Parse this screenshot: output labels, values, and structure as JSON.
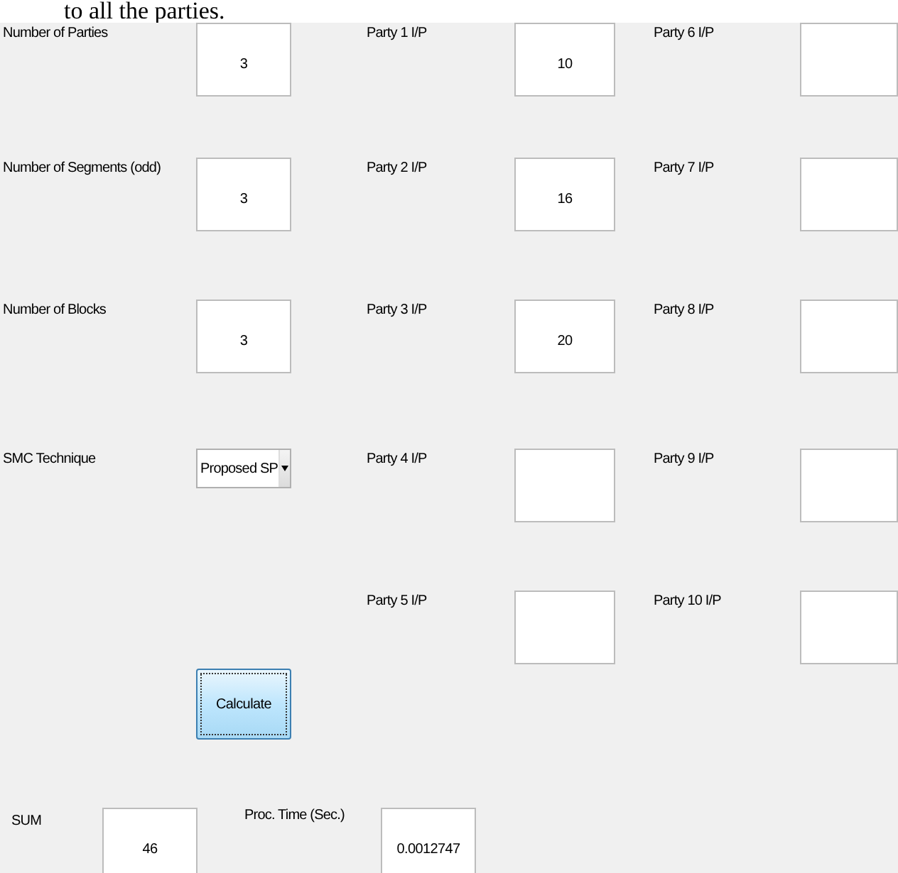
{
  "caption_fragment": "to all the parties.",
  "left_fields": [
    {
      "label": "Number of Parties",
      "value": "3"
    },
    {
      "label": "Number of Segments (odd)",
      "value": "3"
    },
    {
      "label": "Number of Blocks",
      "value": "3"
    }
  ],
  "technique": {
    "label": "SMC Technique",
    "value": "Proposed SP"
  },
  "party_inputs": [
    {
      "label": "Party 1 I/P",
      "value": "10"
    },
    {
      "label": "Party 2 I/P",
      "value": "16"
    },
    {
      "label": "Party 3 I/P",
      "value": "20"
    },
    {
      "label": "Party 4 I/P"
    },
    {
      "label": "Party 5 I/P"
    },
    {
      "label": "Party 6 I/P"
    },
    {
      "label": "Party 7 I/P"
    },
    {
      "label": "Party 8 I/P"
    },
    {
      "label": "Party 9 I/P"
    },
    {
      "label": "Party 10 I/P"
    }
  ],
  "calculate_button": "Calculate",
  "sum": {
    "label": "SUM",
    "value": "46"
  },
  "proc_time": {
    "label": "Proc. Time (Sec.)",
    "value": "0.0012747"
  }
}
